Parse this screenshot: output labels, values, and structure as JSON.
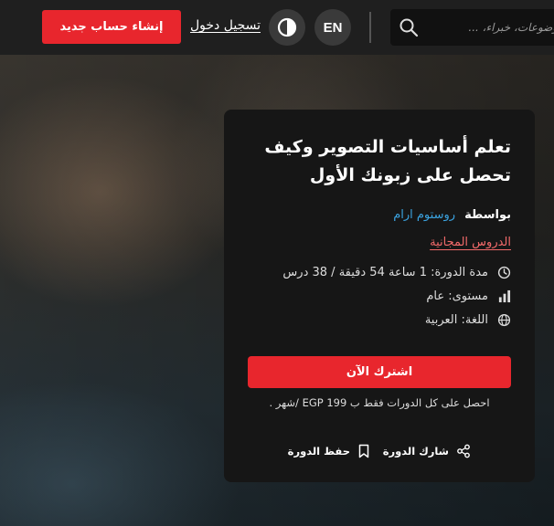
{
  "header": {
    "register_label": "إنشاء حساب جديد",
    "login_label": "تسجيل دخول",
    "language_label": "EN",
    "search_placeholder": "موضوعات، خبراء، ...",
    "icons": {
      "theme": "contrast-icon",
      "search": "search-icon"
    }
  },
  "course": {
    "title": "تعلم أساسيات التصوير وكيف تحصل على زبونك الأول",
    "by_label": "بواسطة",
    "instructor": "روستوم ارام",
    "category": "الدروس المجانية",
    "duration": "مدة الدورة: 1 ساعة 54 دقيقة / 38 درس",
    "level": "مستوى: عام",
    "language": "اللغة: العربية",
    "subscribe_label": "اشترك الآن",
    "price_note": "احصل على كل الدورات فقط ب EGP 199 /شهر .",
    "share_label": "شارك الدورة",
    "save_label": "حفظ الدورة",
    "icons": {
      "duration": "clock-icon",
      "level": "bar-chart-icon",
      "language": "globe-icon",
      "share": "share-icon",
      "save": "bookmark-icon"
    }
  },
  "colors": {
    "accent": "#e8262d",
    "instructor_link": "#3ba3e0",
    "category_link": "#f16a6a",
    "card_bg": "#161616",
    "header_bg": "#1f1f1f"
  }
}
